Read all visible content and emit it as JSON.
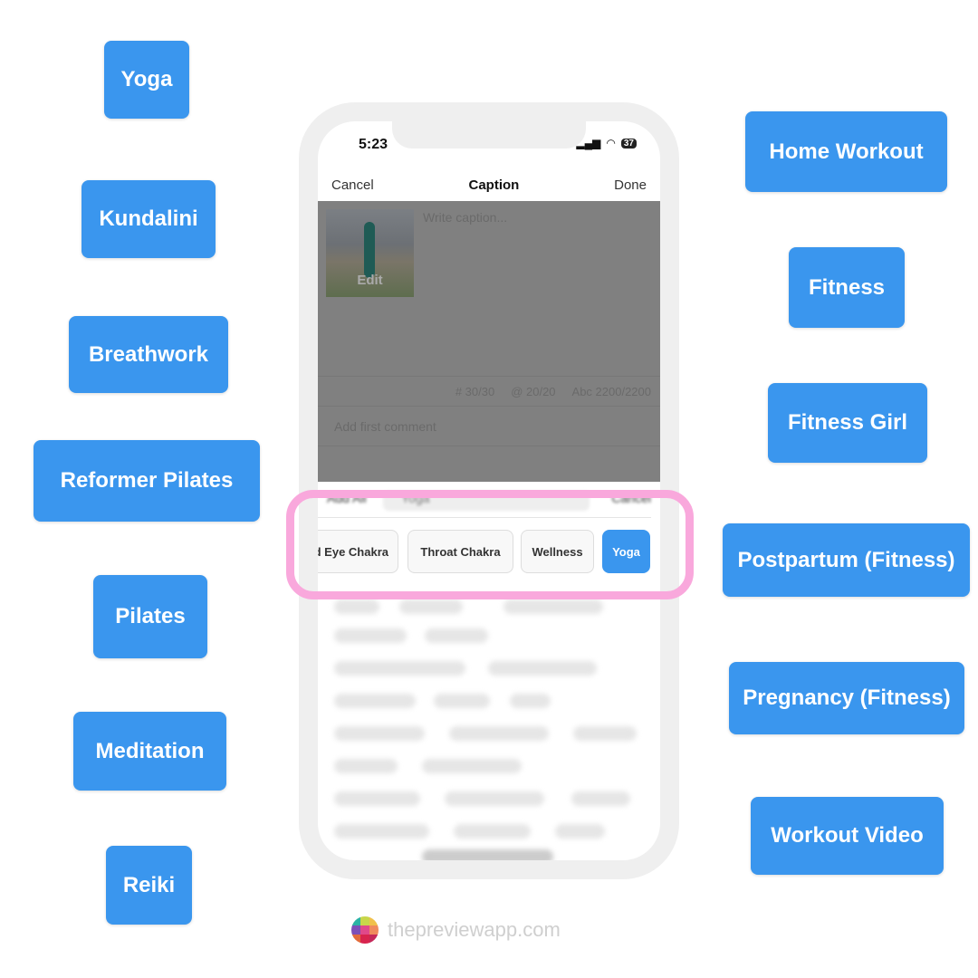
{
  "left_tags": [
    "Yoga",
    "Kundalini",
    "Breathwork",
    "Reformer Pilates",
    "Pilates",
    "Meditation",
    "Reiki"
  ],
  "right_tags": [
    "Home Workout",
    "Fitness",
    "Fitness Girl",
    "Postpartum (Fitness)",
    "Pregnancy (Fitness)",
    "Workout Video"
  ],
  "phone": {
    "time": "5:23",
    "battery": "37",
    "nav": {
      "cancel": "Cancel",
      "title": "Caption",
      "done": "Done"
    },
    "thumb_edit": "Edit",
    "caption_placeholder": "Write caption...",
    "counters": {
      "hashtags": "# 30/30",
      "mentions": "@ 20/20",
      "chars": "Abc 2200/2200"
    },
    "comment_placeholder": "Add first comment",
    "search": {
      "add_all": "Add All",
      "query": "Yoga",
      "cancel": "Cancel"
    },
    "chips": [
      "Third Eye Chakra",
      "Throat Chakra",
      "Wellness",
      "Yoga"
    ],
    "selected_chip": "Yoga"
  },
  "colors": {
    "tag": "#3a96ee",
    "highlight": "#f9a8dc"
  },
  "footer": "thepreviewapp.com"
}
